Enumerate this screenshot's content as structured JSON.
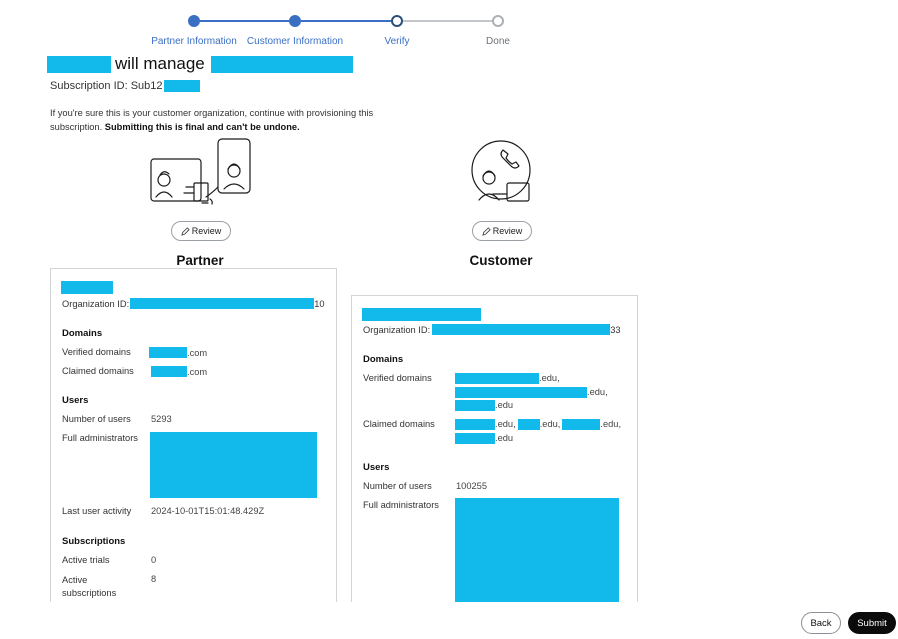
{
  "stepper": {
    "steps": [
      {
        "label": "Partner Information",
        "state": "done"
      },
      {
        "label": "Customer Information",
        "state": "done"
      },
      {
        "label": "Verify",
        "state": "current"
      },
      {
        "label": "Done",
        "state": "upcoming"
      }
    ]
  },
  "header": {
    "title_middle": "will manage",
    "subscription_id_label": "Subscription ID: Sub12",
    "desc_text": "If you're sure this is your customer organization, continue with provisioning this subscription.",
    "desc_bold": "Submitting this is final and can't be undone."
  },
  "partner": {
    "review_label": "Review",
    "title": "Partner",
    "org_id_label": "Organization ID:",
    "org_id_suffix": "10",
    "domains_heading": "Domains",
    "verified_domains_label": "Verified domains",
    "verified_domains_suffix": ".com",
    "claimed_domains_label": "Claimed domains",
    "claimed_domains_suffix": ".com",
    "users_heading": "Users",
    "number_of_users_label": "Number of users",
    "number_of_users": "5293",
    "full_admins_label": "Full administrators",
    "last_activity_label": "Last user activity",
    "last_activity": "2024-10-01T15:01:48.429Z",
    "subscriptions_heading": "Subscriptions",
    "active_trials_label": "Active trials",
    "active_trials": "0",
    "active_subs_label_1": "Active",
    "active_subs_label_2": "subscriptions",
    "active_subs": "8"
  },
  "customer": {
    "review_label": "Review",
    "title": "Customer",
    "org_id_label": "Organization ID:",
    "org_id_suffix": "33",
    "domains_heading": "Domains",
    "verified_domains_label": "Verified domains",
    "verified_suffix_1": ".edu,",
    "verified_suffix_2": ".edu,",
    "verified_suffix_3": ".edu",
    "claimed_domains_label": "Claimed domains",
    "claimed_suffix_1": ".edu,",
    "claimed_suffix_2": ".edu,",
    "claimed_suffix_3": ".edu,",
    "claimed_suffix_4": ".edu",
    "users_heading": "Users",
    "number_of_users_label": "Number of users",
    "number_of_users": "100255",
    "full_admins_label": "Full administrators"
  },
  "footer": {
    "back_label": "Back",
    "submit_label": "Submit"
  },
  "colors": {
    "redaction": "#12baec",
    "accent": "#3a6fc4",
    "submit_bg": "#0b0b0b"
  }
}
